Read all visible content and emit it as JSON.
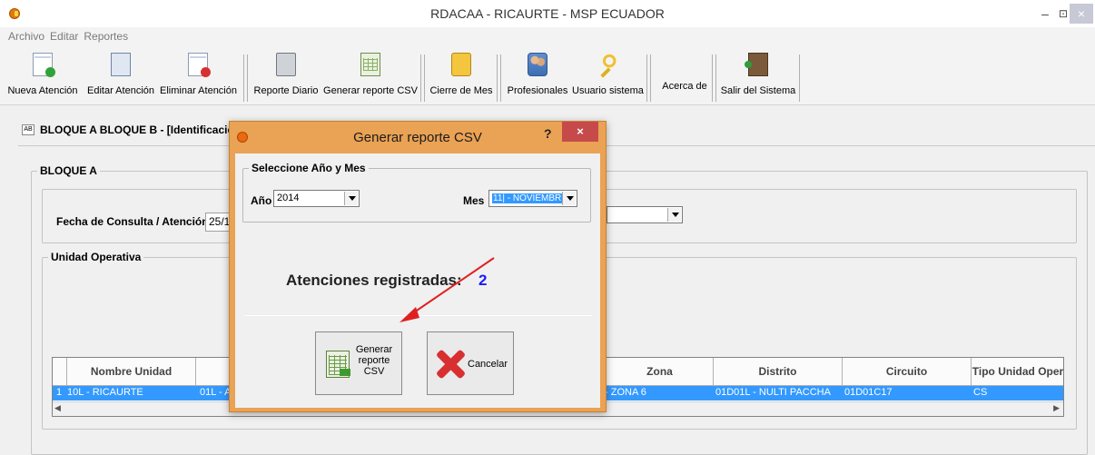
{
  "window": {
    "title": "RDACAA - RICAURTE - MSP ECUADOR",
    "min": "–",
    "max": "⊡",
    "close": "×"
  },
  "menu": [
    "Archivo",
    "Editar",
    "Reportes"
  ],
  "toolbar": {
    "new": "Nueva Atención",
    "edit": "Editar Atención",
    "delete": "Eliminar Atención",
    "daily": "Reporte Diario",
    "csv": "Generar reporte CSV",
    "close_month": "Cierre de Mes",
    "professionals": "Profesionales",
    "users": "Usuario sistema",
    "about": "Acerca de",
    "exit": "Salir del Sistema"
  },
  "tab": {
    "icon": "AB",
    "title": "BLOQUE A  BLOQUE B  -  [Identificació"
  },
  "bloque_a": {
    "title": "BLOQUE A",
    "fecha_label": "Fecha de Consulta / Atención:",
    "fecha_value": "25/1"
  },
  "unidad": {
    "title": "Unidad Operativa",
    "columns": [
      "Nombre Unidad",
      "Zona",
      "Distrito",
      "Circuito",
      "Tipo Unidad Oper"
    ],
    "row": {
      "num": "1",
      "nombre": "10L - RICAURTE",
      "col2": "01L - A",
      "zona": "- ZONA 6",
      "distrito": "01D01L - NULTI  PACCHA",
      "circuito": "01D01C17",
      "tipo": "CS"
    }
  },
  "dialog": {
    "title": "Generar reporte CSV",
    "help": "?",
    "close": "×",
    "group_title": "Seleccione Año y Mes",
    "year_label": "Año",
    "year_value": "2014",
    "month_label": "Mes",
    "month_value": "11| - NOVIEMBRE",
    "count_label": "Atenciones registradas:",
    "count_value": "2",
    "generate_label": "Generar\nreporte\nCSV",
    "cancel_label": "Cancelar"
  },
  "colors": {
    "dialog_frame": "#eaa254",
    "selection": "#3399ff",
    "count": "#1a1aff",
    "annotation_arrow": "#e02020"
  }
}
